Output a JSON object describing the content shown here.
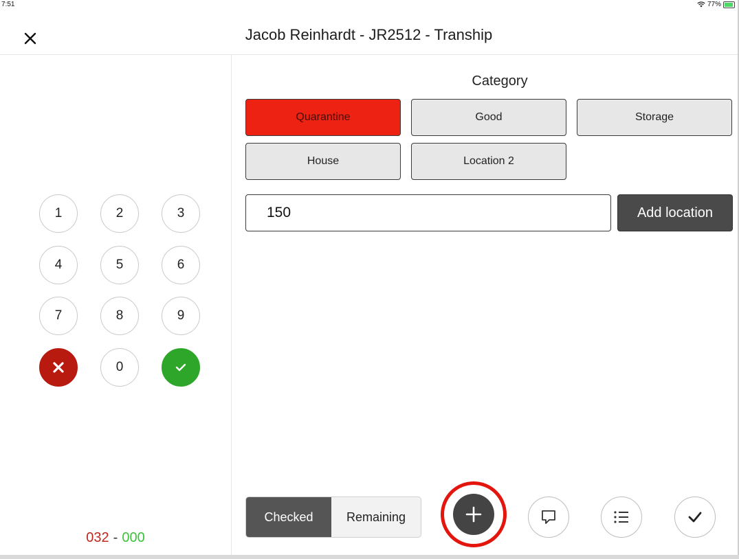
{
  "status": {
    "time": "7:51",
    "battery_percent": "77%",
    "battery_level": 0.77
  },
  "header": {
    "title": "Jacob Reinhardt - JR2512 - Tranship",
    "close_icon": "close-icon"
  },
  "keypad": {
    "keys": [
      "1",
      "2",
      "3",
      "4",
      "5",
      "6",
      "7",
      "8",
      "9",
      "0"
    ],
    "cancel_icon": "x-icon",
    "confirm_icon": "check-icon",
    "colors": {
      "cancel": "#b81a10",
      "confirm": "#2ea62a"
    }
  },
  "counter": {
    "checked": "032",
    "separator": "-",
    "remaining": "000"
  },
  "category": {
    "label": "Category",
    "options": [
      "Quarantine",
      "Good",
      "Storage",
      "House",
      "Location 2"
    ],
    "selected": "Quarantine",
    "active_color": "#ee2212"
  },
  "location": {
    "value": "150",
    "add_label": "Add location"
  },
  "toggle": {
    "checked_label": "Checked",
    "remaining_label": "Remaining",
    "selected": "Checked"
  },
  "actions": {
    "add_icon": "plus-icon",
    "comment_icon": "speech-bubble-icon",
    "list_icon": "list-icon",
    "done_icon": "checkmark-icon",
    "highlight_color": "#e3150d"
  }
}
